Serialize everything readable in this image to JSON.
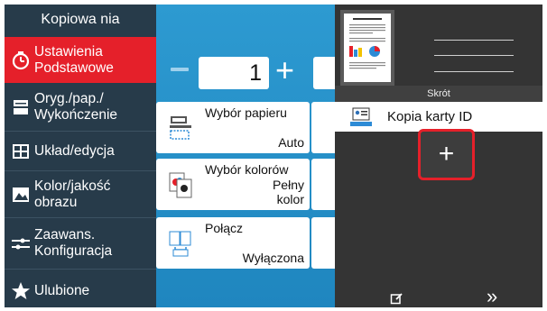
{
  "sidebar": {
    "title": "Kopiowa nia",
    "items": [
      {
        "label_1": "Ustawienia",
        "label_2": "Podstawowe",
        "icon": "timer-icon"
      },
      {
        "label_1": "Oryg./pap./",
        "label_2": "Wykończenie",
        "icon": "original-paper-icon"
      },
      {
        "label_1": "Układ/edycja",
        "label_2": "",
        "icon": "layout-icon"
      },
      {
        "label_1": "Kolor/jakość",
        "label_2": "obrazu",
        "icon": "image-quality-icon"
      },
      {
        "label_1": "Zaawans.",
        "label_2": "Konfiguracja",
        "icon": "advanced-icon"
      },
      {
        "label_1": "Ulubione",
        "label_2": "",
        "icon": "star-icon"
      }
    ]
  },
  "copies": {
    "value": "1",
    "minus": "−",
    "plus": "+"
  },
  "cards": [
    {
      "title": "Wybór papieru",
      "value": "Auto",
      "icon": "paper-select-icon"
    },
    {
      "title": "Wybór kolorów",
      "value_1": "Pełny",
      "value_2": "kolor",
      "icon": "color-select-icon"
    },
    {
      "title": "Połącz",
      "value": "Wyłączona",
      "icon": "combine-icon"
    }
  ],
  "right_panel": {
    "band_label": "Skrót",
    "shortcut_label": "Kopia karty ID",
    "add_label": "+",
    "next_label": "»"
  },
  "colors": {
    "accent": "#e5202a",
    "sidebar": "#273b4a",
    "center": "#2d9ad1",
    "right": "#343434"
  }
}
